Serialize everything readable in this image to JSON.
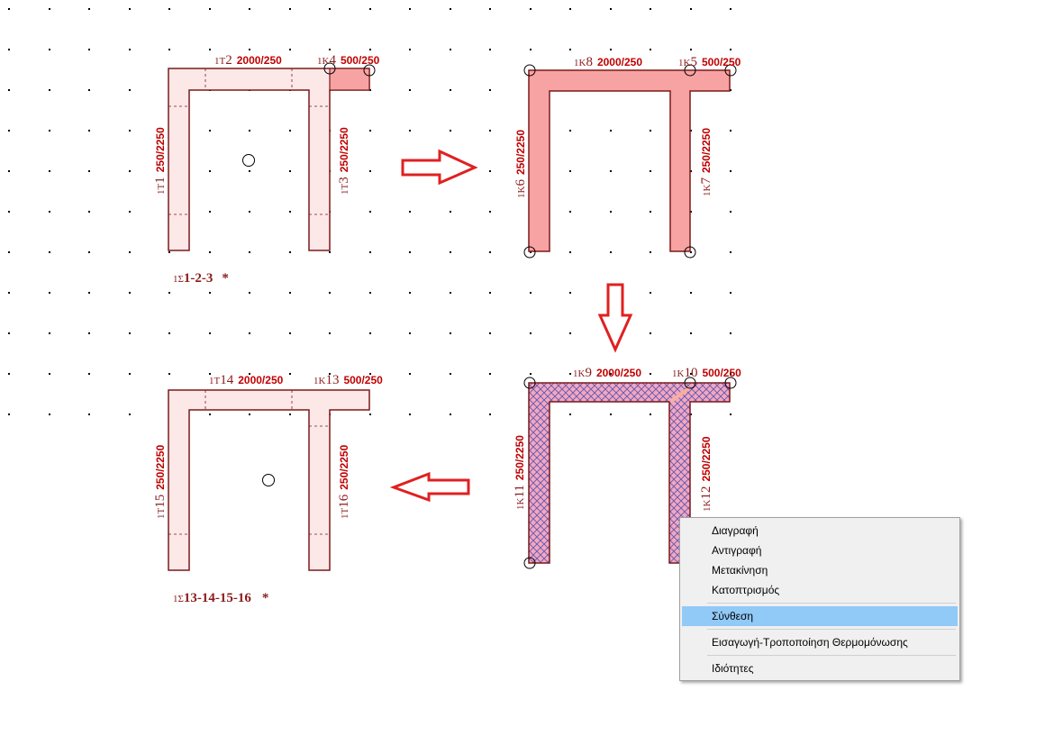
{
  "context_menu": {
    "items": [
      {
        "label": "Διαγραφή"
      },
      {
        "label": "Αντιγραφή"
      },
      {
        "label": "Μετακίνηση"
      },
      {
        "label": "Κατοπτρισμός"
      },
      {
        "label": "Σύνθεση",
        "highlighted": true
      },
      {
        "label": "Εισαγωγή-Τροποποίηση Θερμομόνωσης"
      },
      {
        "label": "Ιδιότητες"
      }
    ]
  },
  "colors": {
    "wall_stroke": "#7a1a1a",
    "light_fill": "#fde8e8",
    "solid_fill": "#f7a3a3",
    "hatch": "#5a5ab0",
    "arrow": "#e02020",
    "menu_highlight": "#91c9f7"
  },
  "shapes": {
    "top_left": {
      "tags": [
        {
          "prefix": "1Τ",
          "num": "2",
          "dim": "2000/250"
        },
        {
          "prefix": "1Κ",
          "num": "4",
          "dim": "500/250"
        },
        {
          "prefix": "1Τ",
          "num": "1",
          "dim": "250/2250"
        },
        {
          "prefix": "1Τ",
          "num": "3",
          "dim": "250/2250"
        }
      ],
      "group_prefix": "1Σ",
      "group_label": "1-2-3",
      "star": "*"
    },
    "top_right": {
      "tags": [
        {
          "prefix": "1Κ",
          "num": "8",
          "dim": "2000/250"
        },
        {
          "prefix": "1Κ",
          "num": "5",
          "dim": "500/250"
        },
        {
          "prefix": "1Κ",
          "num": "6",
          "dim": "250/2250"
        },
        {
          "prefix": "1Κ",
          "num": "7",
          "dim": "250/2250"
        }
      ]
    },
    "bottom_right": {
      "tags": [
        {
          "prefix": "1Κ",
          "num": "9",
          "dim": "2000/250"
        },
        {
          "prefix": "1Κ",
          "num": "10",
          "dim": "500/250"
        },
        {
          "prefix": "1Κ",
          "num": "11",
          "dim": "250/2250"
        },
        {
          "prefix": "1Κ",
          "num": "12",
          "dim": "250/2250"
        }
      ]
    },
    "bottom_left": {
      "tags": [
        {
          "prefix": "1Τ",
          "num": "14",
          "dim": "2000/250"
        },
        {
          "prefix": "1Κ",
          "num": "13",
          "dim": "500/250"
        },
        {
          "prefix": "1Τ",
          "num": "15",
          "dim": "250/2250"
        },
        {
          "prefix": "1Τ",
          "num": "16",
          "dim": "250/2250"
        }
      ],
      "group_prefix": "1Σ",
      "group_label": "13-14-15-16",
      "star": "*"
    }
  }
}
